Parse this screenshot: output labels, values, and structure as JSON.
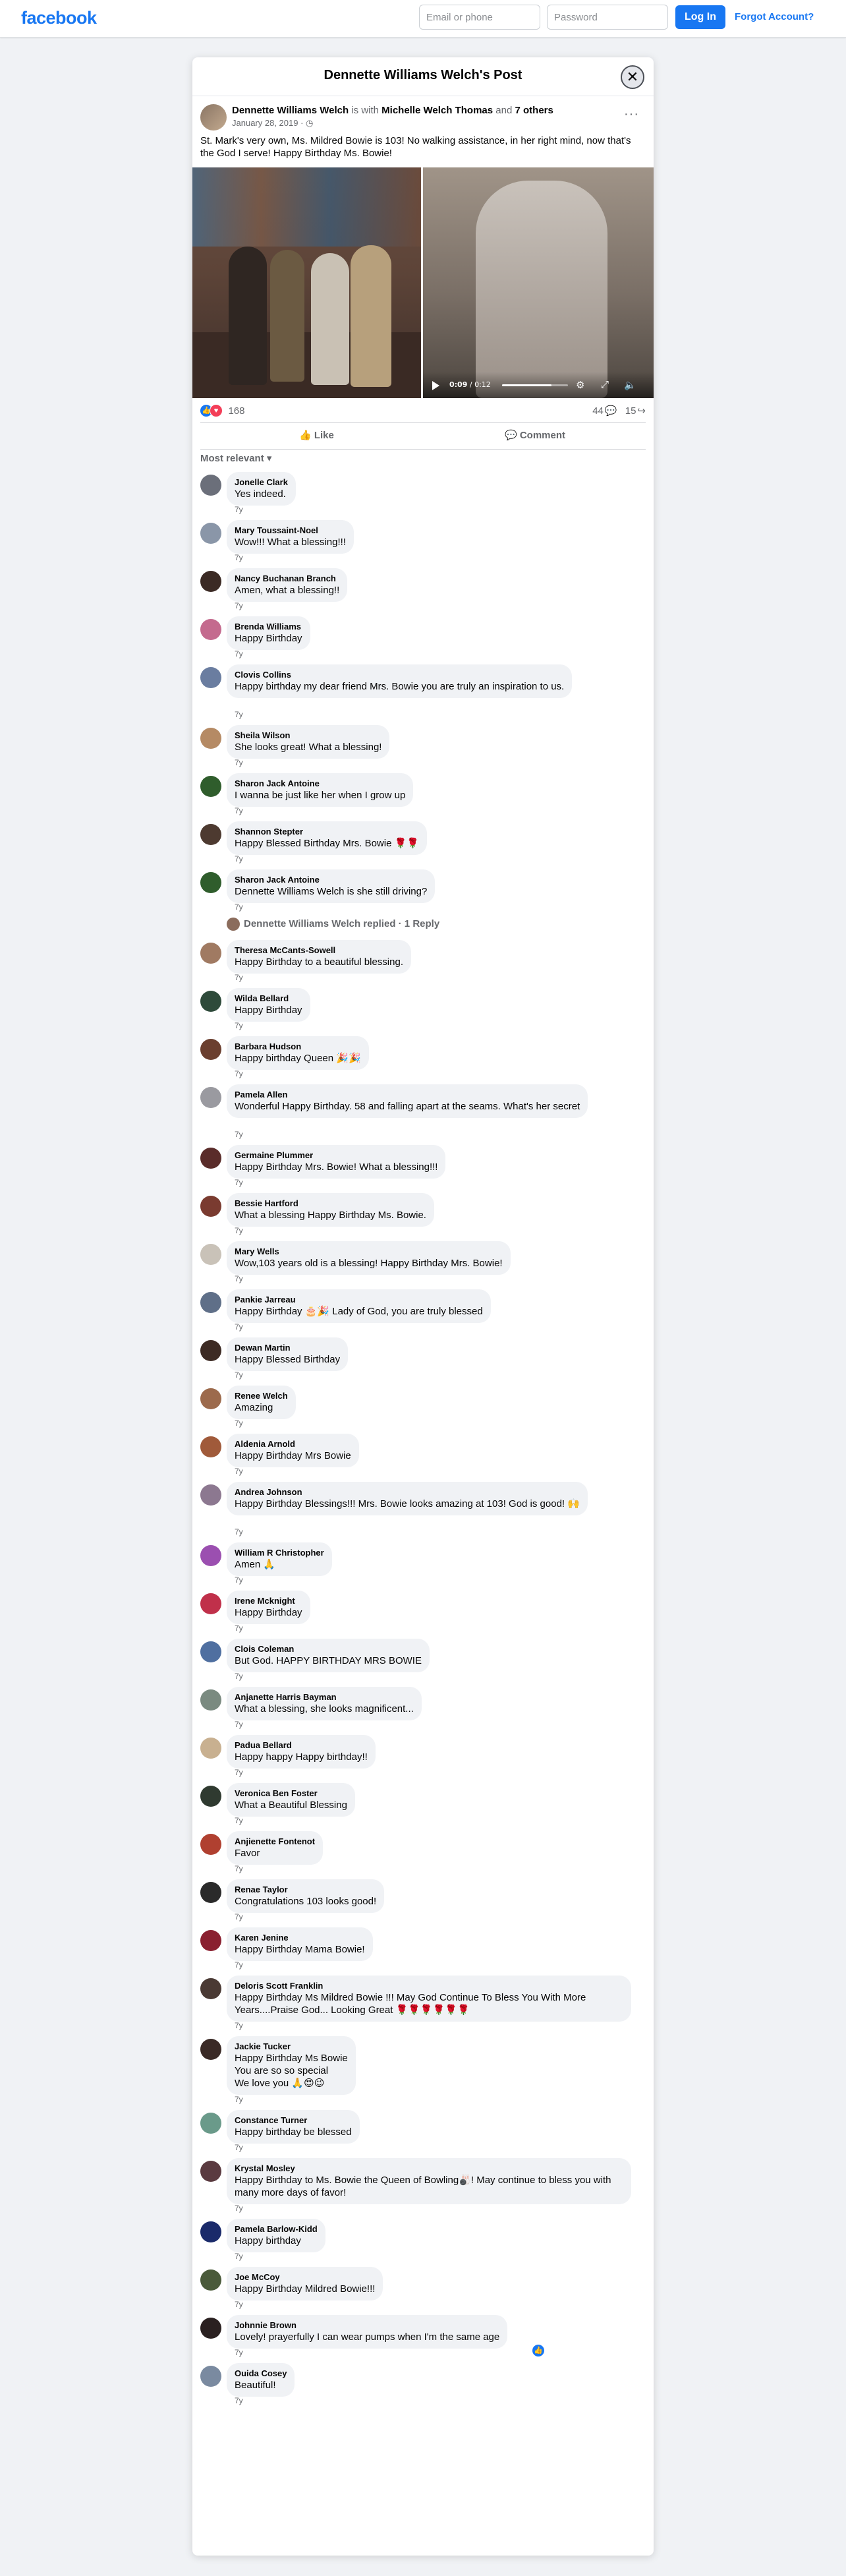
{
  "topbar": {
    "logo": "facebook",
    "email_placeholder": "Email or phone",
    "password_placeholder": "Password",
    "login_label": "Log In",
    "forgot_label": "Forgot Account?"
  },
  "modal": {
    "title": "Dennette Williams Welch's Post",
    "close_glyph": "✕"
  },
  "post": {
    "author": "Dennette Williams Welch",
    "with_word": "is with",
    "with_name": "Michelle Welch Thomas",
    "and_word": "and",
    "others": "7 others",
    "date": "January 28, 2019 · ◷",
    "text": "St. Mark's very own, Ms. Mildred Bowie is 103! No walking assistance, in her right mind, now that's the God I serve! Happy Birthday Ms. Bowie!",
    "more_glyph": "···"
  },
  "video": {
    "current": "0:09",
    "total": "/ 0:12",
    "progress": 0.75
  },
  "reactions": {
    "count": "168",
    "comments": "44",
    "comment_glyph": "💬",
    "shares": "15",
    "share_glyph": "↪"
  },
  "actions": {
    "like": "👍 Like",
    "comment": "💬 Comment"
  },
  "sort": "Most relevant ▾",
  "comments": [
    {
      "name": "Jonelle Clark",
      "text": "Yes indeed.",
      "time": "7y",
      "color": "#6b6f7a"
    },
    {
      "name": "Mary Toussaint-Noel",
      "text": "Wow!!! What a blessing!!!",
      "time": "7y",
      "color": "#8a96a8"
    },
    {
      "name": "Nancy Buchanan Branch",
      "text": "Amen, what a blessing!!",
      "time": "7y",
      "color": "#3b2a24"
    },
    {
      "name": "Brenda Williams",
      "text": "Happy Birthday",
      "time": "7y",
      "color": "#c46a8e"
    },
    {
      "name": "Clovis Collins",
      "text": "Happy birthday my dear friend Mrs. Bowie you are truly an inspiration to us.",
      "time": "7y",
      "color": "#6a7da0"
    },
    {
      "name": "Sheila Wilson",
      "text": "She looks great! What a blessing!",
      "time": "7y",
      "color": "#b58a64"
    },
    {
      "name": "Sharon Jack Antoine",
      "text": "I wanna be just like her when I grow up",
      "time": "7y",
      "color": "#2f5d2c"
    },
    {
      "name": "Shannon Stepter",
      "text": "Happy Blessed Birthday Mrs. Bowie 🌹🌹",
      "time": "7y",
      "color": "#4d3a30"
    },
    {
      "name": "Sharon Jack Antoine",
      "text": "Dennette Williams Welch is she still driving?",
      "time": "7y",
      "color": "#2f5d2c"
    },
    {
      "name": "Theresa McCants-Sowell",
      "text": "Happy Birthday to a beautiful blessing.",
      "time": "7y",
      "color": "#a07a62"
    },
    {
      "name": "Wilda Bellard",
      "text": "Happy Birthday",
      "time": "7y",
      "color": "#2e4a3a"
    },
    {
      "name": "Barbara Hudson",
      "text": "Happy birthday Queen 🎉🎉",
      "time": "7y",
      "color": "#6b3f2f"
    },
    {
      "name": "Pamela Allen",
      "text": "Wonderful Happy Birthday. 58 and falling apart at the seams. What's her secret",
      "time": "7y",
      "color": "#9a9aa0"
    },
    {
      "name": "Germaine Plummer",
      "text": "Happy Birthday Mrs. Bowie! What a blessing!!!",
      "time": "7y",
      "color": "#5a2c2a"
    },
    {
      "name": "Bessie Hartford",
      "text": "What a blessing Happy Birthday Ms. Bowie.",
      "time": "7y",
      "color": "#7a3b30"
    },
    {
      "name": "Mary Wells",
      "text": "Wow,103 years old is a blessing! Happy Birthday Mrs. Bowie!",
      "time": "7y",
      "color": "#c9c2b8"
    },
    {
      "name": "Pankie Jarreau",
      "text": "Happy Birthday 🎂🎉 Lady of God, you are truly blessed",
      "time": "7y",
      "color": "#5f6f88"
    },
    {
      "name": "Dewan Martin",
      "text": "Happy Blessed Birthday",
      "time": "7y",
      "color": "#3d2b24"
    },
    {
      "name": "Renee Welch",
      "text": "Amazing",
      "time": "7y",
      "color": "#9c6a4c"
    },
    {
      "name": "Aldenia Arnold",
      "text": "Happy Birthday Mrs Bowie",
      "time": "7y",
      "color": "#a05a3a"
    },
    {
      "name": "Andrea Johnson",
      "text": "Happy Birthday Blessings!!! Mrs. Bowie looks amazing at 103! God is good! 🙌",
      "time": "7y",
      "color": "#8c7890"
    },
    {
      "name": "William R Christopher",
      "text": "Amen 🙏",
      "time": "7y",
      "color": "#9b4fb0"
    },
    {
      "name": "Irene Mcknight",
      "text": "Happy Birthday",
      "time": "7y",
      "color": "#c0304a"
    },
    {
      "name": "Clois Coleman",
      "text": "But God. HAPPY BIRTHDAY MRS BOWIE",
      "time": "7y",
      "color": "#4f6fa0"
    },
    {
      "name": "Anjanette Harris Bayman",
      "text": "What a blessing, she looks magnificent...",
      "time": "7y",
      "color": "#7a8a80"
    },
    {
      "name": "Padua Bellard",
      "text": "Happy happy Happy birthday!!",
      "time": "7y",
      "color": "#c8b090"
    },
    {
      "name": "Veronica Ben Foster",
      "text": "What a Beautiful Blessing",
      "time": "7y",
      "color": "#2f3a30"
    },
    {
      "name": "Anjienette Fontenot",
      "text": "Favor",
      "time": "7y",
      "color": "#b04030"
    },
    {
      "name": "Renae Taylor",
      "text": "Congratulations 103 looks good!",
      "time": "7y",
      "color": "#2a2a2a"
    },
    {
      "name": "Karen Jenine",
      "text": "Happy Birthday Mama Bowie!",
      "time": "7y",
      "color": "#8a2030"
    },
    {
      "name": "Deloris Scott Franklin",
      "text": "Happy Birthday Ms Mildred Bowie !!! May God Continue To Bless You With More Years....Praise God... Looking Great 🌹🌹🌹🌹🌹🌹",
      "time": "7y",
      "color": "#4a3a34"
    },
    {
      "name": "Jackie Tucker",
      "text": "Happy Birthday Ms Bowie\nYou are so so special\nWe love you 🙏😍😉",
      "time": "7y",
      "color": "#3a2a26"
    },
    {
      "name": "Constance Turner",
      "text": "Happy birthday be blessed",
      "time": "7y",
      "color": "#6a9a8a"
    },
    {
      "name": "Krystal Mosley",
      "text": "Happy Birthday to Ms. Bowie the Queen of Bowling🎳! May continue to bless you with many more days of favor!",
      "time": "7y",
      "color": "#5a3a40"
    },
    {
      "name": "Pamela Barlow-Kidd",
      "text": "Happy birthday",
      "time": "7y",
      "color": "#1a2a6a"
    },
    {
      "name": "Joe McCoy",
      "text": "Happy Birthday Mildred Bowie!!!",
      "time": "7y",
      "color": "#4a5a3a"
    },
    {
      "name": "Johnnie Brown",
      "text": "Lovely! prayerfully I can wear pumps when I'm the same age",
      "time": "7y",
      "color": "#2a2020"
    },
    {
      "name": "Ouida Cosey",
      "text": "Beautiful!",
      "time": "7y",
      "color": "#7a8aa0"
    }
  ],
  "reply": {
    "text": "Dennette Williams Welch replied · 1 Reply"
  }
}
